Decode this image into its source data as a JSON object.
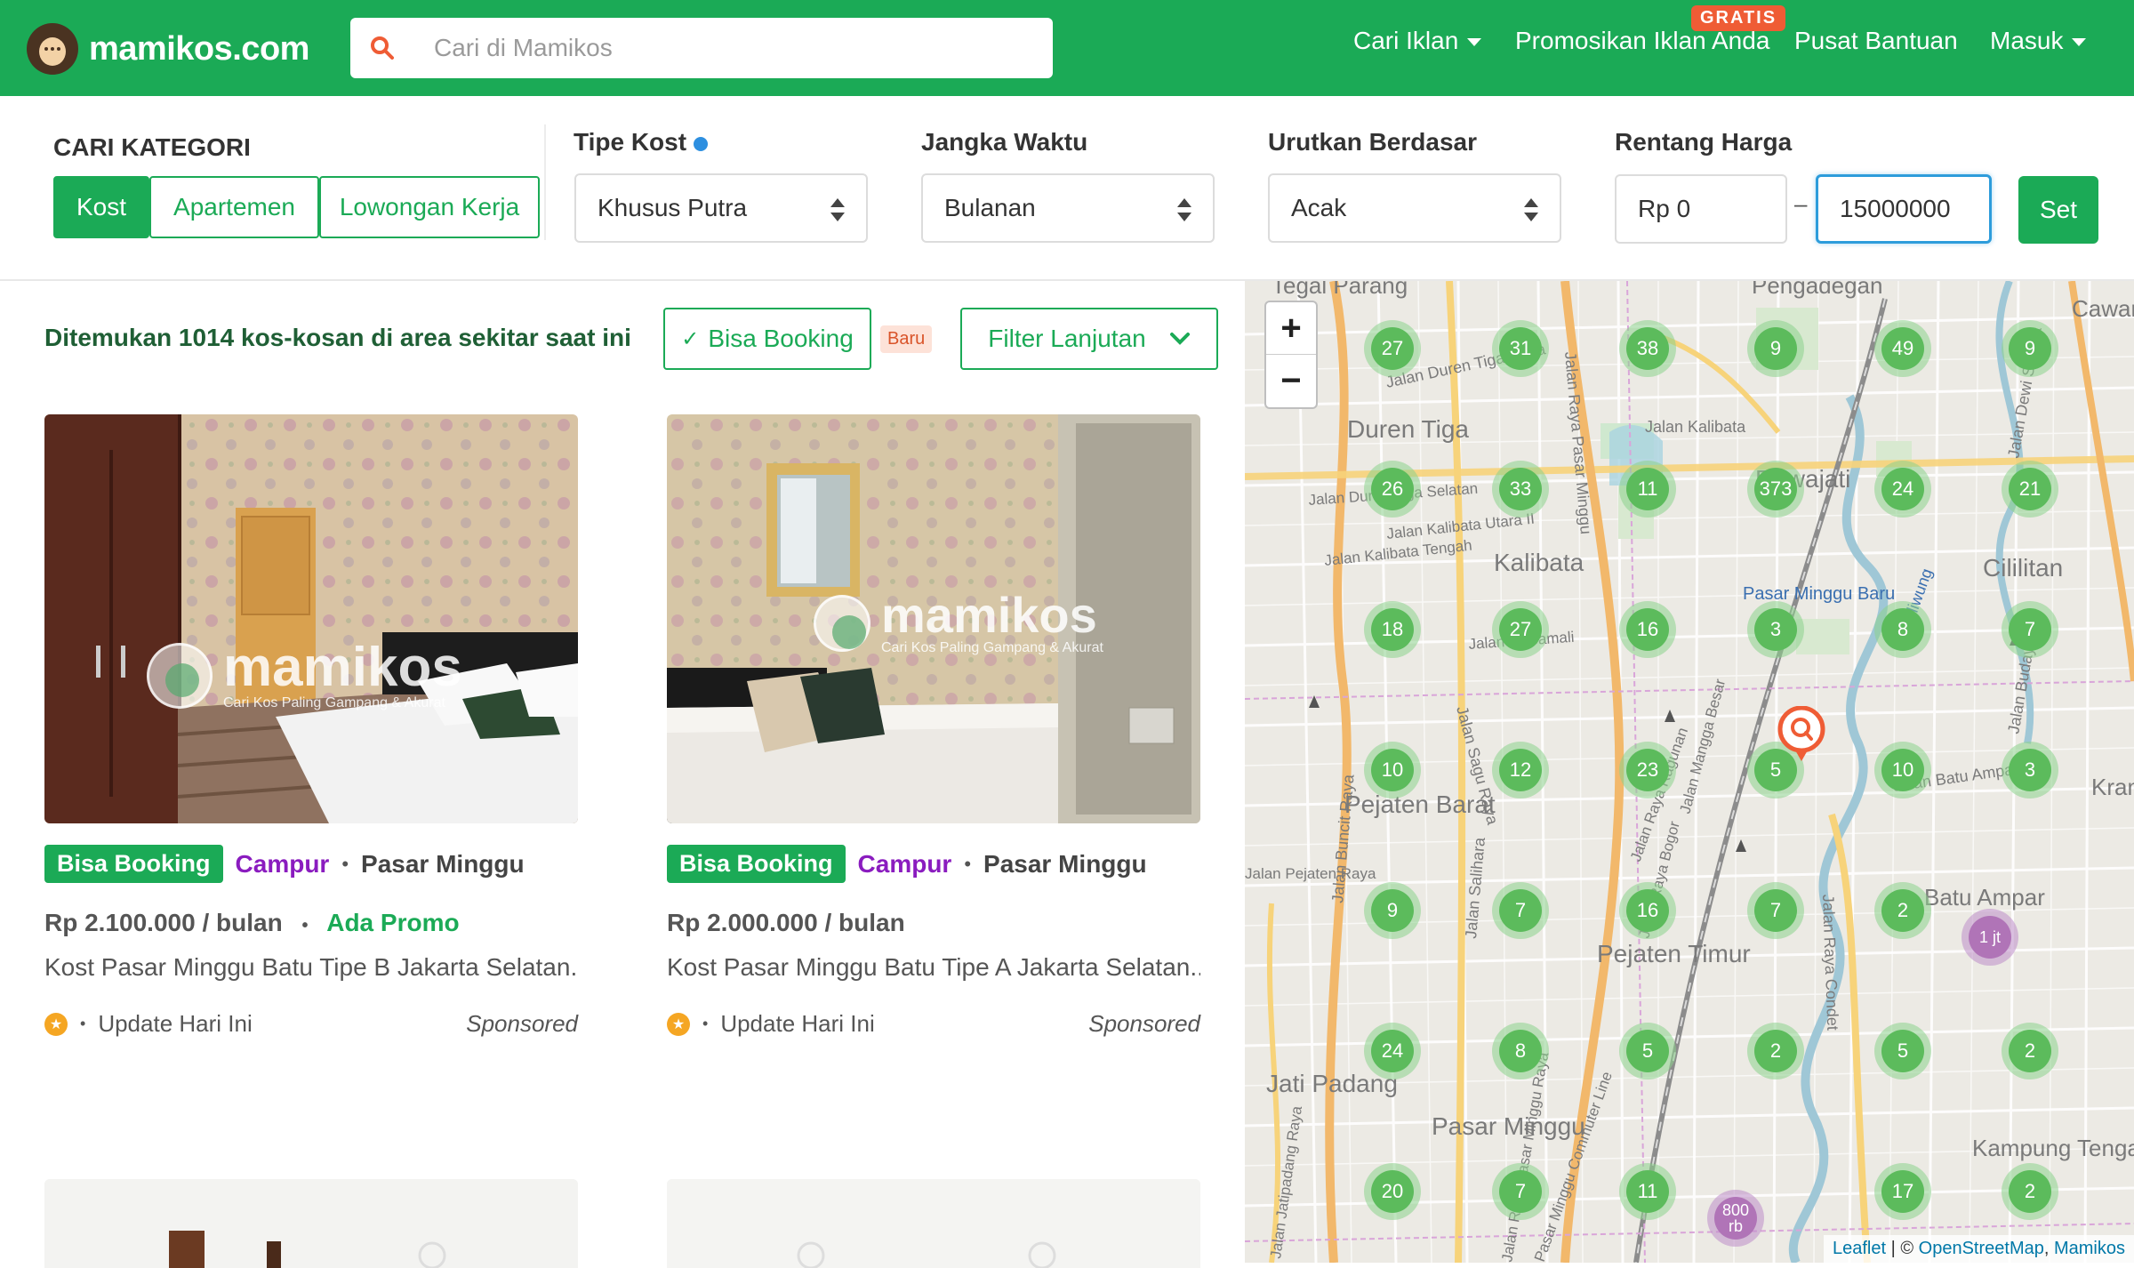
{
  "nav": {
    "logo_text": "mamikos.com",
    "search_placeholder": "Cari di Mamikos",
    "links": [
      "Cari Iklan",
      "Promosikan Iklan Anda",
      "Pusat Bantuan",
      "Masuk"
    ],
    "gratis_badge": "GRATIS"
  },
  "filters": {
    "category_title": "CARI KATEGORI",
    "categories": [
      "Kost",
      "Apartemen",
      "Lowongan Kerja"
    ],
    "tipe_title": "Tipe Kost",
    "tipe_value": "Khusus Putra",
    "jangka_title": "Jangka Waktu",
    "jangka_value": "Bulanan",
    "urut_title": "Urutkan Berdasar",
    "urut_value": "Acak",
    "harga_title": "Rentang Harga",
    "harga_min": "Rp 0",
    "harga_sep": "–",
    "harga_max": "15000000",
    "set_label": "Set"
  },
  "list": {
    "found_text": "Ditemukan 1014 kos-kosan di area sekitar saat ini",
    "bisa_booking_toggle": "Bisa Booking",
    "baru_badge": "Baru",
    "filter_lanjutan": "Filter Lanjutan",
    "cards": [
      {
        "badge": "Bisa Booking",
        "gender": "Campur",
        "location": "Pasar Minggu",
        "price": "Rp 2.100.000 / bulan",
        "promo": "Ada Promo",
        "title": "Kost Pasar Minggu Batu Tipe B Jakarta Selatan...",
        "update": "Update Hari Ini",
        "sponsored": "Sponsored",
        "watermark": "mamikos",
        "watermark_sub": "Cari Kos Paling Gampang & Akurat"
      },
      {
        "badge": "Bisa Booking",
        "gender": "Campur",
        "location": "Pasar Minggu",
        "price": "Rp 2.000.000 / bulan",
        "promo": "",
        "title": "Kost Pasar Minggu Batu Tipe A Jakarta Selatan...",
        "update": "Update Hari Ini",
        "sponsored": "Sponsored",
        "watermark": "mamikos",
        "watermark_sub": "Cari Kos Paling Gampang & Akurat"
      }
    ]
  },
  "map": {
    "zoom_in": "+",
    "zoom_out": "−",
    "place_labels": [
      "Tegal Parang",
      "Pengadegan",
      "Cawang",
      "Duren Tiga",
      "Pejaten Barat",
      "Pejaten Timur",
      "Pasar Minggu",
      "Jati Padang",
      "Kalibata",
      "Rawajati",
      "Cililitan",
      "Kampung Tengah",
      "Batu Ampar",
      "Kramat",
      "Pasar Minggu Baru",
      "Jalan Kalibata",
      "Jalan Duren Tiga Raya",
      "Jalan Raya Pasar Minggu",
      "Jalan Buncit Raya",
      "Jalan Sagu Raya",
      "Jalan Salihara",
      "Jalan Raya Condet",
      "Jalan Budaya",
      "Jalan Batu Ampar 3",
      "Jalan Dewi Sartika",
      "Jalan Duren Tiga Selatan",
      "Jalan Kalibata Utara II",
      "Jalan Kalibata Tengah",
      "Jalan H. Samali",
      "Jalan Raya Bogor",
      "Jalan Mangga Besar",
      "Ciliwung",
      "Jalan Raya Ragunan",
      "Jalan Jatipadang Raya",
      "Pasar Minggu Commuter Line",
      "Jalan Raya Pasar Minggu Raya",
      "Jalan Pejaten Raya"
    ],
    "clusters": [
      {
        "count": "27",
        "color": "green"
      },
      {
        "count": "31",
        "color": "green"
      },
      {
        "count": "38",
        "color": "green"
      },
      {
        "count": "9",
        "color": "green"
      },
      {
        "count": "49",
        "color": "green"
      },
      {
        "count": "9",
        "color": "green"
      },
      {
        "count": "26",
        "color": "green"
      },
      {
        "count": "33",
        "color": "green"
      },
      {
        "count": "11",
        "color": "green"
      },
      {
        "count": "373",
        "color": "green"
      },
      {
        "count": "24",
        "color": "green"
      },
      {
        "count": "21",
        "color": "green"
      },
      {
        "count": "18",
        "color": "green"
      },
      {
        "count": "27",
        "color": "green"
      },
      {
        "count": "16",
        "color": "green"
      },
      {
        "count": "3",
        "color": "green"
      },
      {
        "count": "8",
        "color": "green"
      },
      {
        "count": "7",
        "color": "green"
      },
      {
        "count": "10",
        "color": "green"
      },
      {
        "count": "12",
        "color": "green"
      },
      {
        "count": "23",
        "color": "green"
      },
      {
        "count": "5",
        "color": "green"
      },
      {
        "count": "10",
        "color": "green"
      },
      {
        "count": "3",
        "color": "green"
      },
      {
        "count": "9",
        "color": "green"
      },
      {
        "count": "7",
        "color": "green"
      },
      {
        "count": "16",
        "color": "green"
      },
      {
        "count": "7",
        "color": "green"
      },
      {
        "count": "2",
        "color": "green"
      },
      {
        "count": "1 jt",
        "color": "purple"
      },
      {
        "count": "24",
        "color": "green"
      },
      {
        "count": "8",
        "color": "green"
      },
      {
        "count": "5",
        "color": "green"
      },
      {
        "count": "2",
        "color": "green"
      },
      {
        "count": "5",
        "color": "green"
      },
      {
        "count": "2",
        "color": "green"
      },
      {
        "count": "20",
        "color": "green"
      },
      {
        "count": "7",
        "color": "green"
      },
      {
        "count": "11",
        "color": "green"
      },
      {
        "count": "800 rb",
        "color": "purple"
      },
      {
        "count": "17",
        "color": "green"
      },
      {
        "count": "2",
        "color": "green"
      }
    ],
    "attribution_leaflet": "Leaflet",
    "attribution_sep": " | © ",
    "attribution_osm": "OpenStreetMap",
    "attribution_comma": ", ",
    "attribution_mamikos": "Mamikos"
  },
  "colors": {
    "brand_green": "#1baa56",
    "purple": "#8a1cbf",
    "accent_orange": "#ef5c35",
    "focus_blue": "#2d9cdb"
  }
}
